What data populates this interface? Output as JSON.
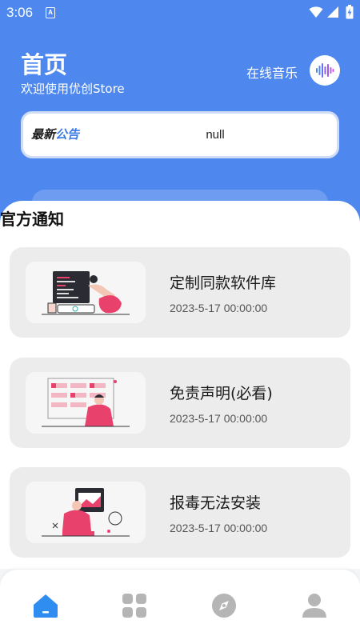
{
  "status_bar": {
    "time": "3:06",
    "notification_icon": "a-letter-icon",
    "icons": [
      "wifi-icon",
      "signal-icon",
      "battery-charging-icon"
    ]
  },
  "header": {
    "title": "首页",
    "subtitle": "欢迎使用优创Store",
    "music_label": "在线音乐",
    "music_icon": "sound-wave-icon"
  },
  "notice": {
    "logo_part1": "最新",
    "logo_part2": "公告",
    "text": "null"
  },
  "section": {
    "title": "官方通知"
  },
  "news": [
    {
      "title": "定制同款软件库",
      "date": "2023-5-17 00:00:00"
    },
    {
      "title": "免责声明(必看)",
      "date": "2023-5-17 00:00:00"
    },
    {
      "title": "报毒无法安装",
      "date": "2023-5-17 00:00:00"
    }
  ],
  "tabs": [
    {
      "icon": "home-icon",
      "active": true
    },
    {
      "icon": "apps-grid-icon",
      "active": false
    },
    {
      "icon": "compass-icon",
      "active": false
    },
    {
      "icon": "user-icon",
      "active": false
    }
  ],
  "colors": {
    "primary": "#4e88ef",
    "active_tab": "#2f8cf0",
    "inactive_tab": "#b5b5b5",
    "accent_pink": "#e8416c"
  }
}
